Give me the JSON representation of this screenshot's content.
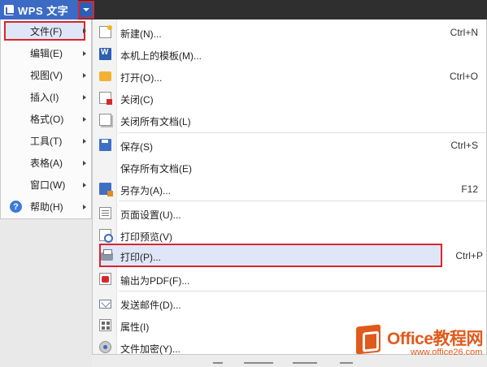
{
  "app": {
    "title": "WPS 文字"
  },
  "main_menu": {
    "items": [
      {
        "label": "文件(F)"
      },
      {
        "label": "编辑(E)"
      },
      {
        "label": "视图(V)"
      },
      {
        "label": "插入(I)"
      },
      {
        "label": "格式(O)"
      },
      {
        "label": "工具(T)"
      },
      {
        "label": "表格(A)"
      },
      {
        "label": "窗口(W)"
      },
      {
        "label": "帮助(H)"
      }
    ]
  },
  "file_menu": {
    "items": [
      {
        "label": "新建(N)...",
        "shortcut": "Ctrl+N",
        "icon": "new-document-icon"
      },
      {
        "label": "本机上的模板(M)...",
        "shortcut": "",
        "icon": "template-icon"
      },
      {
        "label": "打开(O)...",
        "shortcut": "Ctrl+O",
        "icon": "open-folder-icon"
      },
      {
        "label": "关闭(C)",
        "shortcut": "",
        "icon": "close-document-icon"
      },
      {
        "label": "关闭所有文档(L)",
        "shortcut": "",
        "icon": "close-all-icon"
      },
      {
        "label": "保存(S)",
        "shortcut": "Ctrl+S",
        "icon": "save-icon"
      },
      {
        "label": "保存所有文档(E)",
        "shortcut": "",
        "icon": ""
      },
      {
        "label": "另存为(A)...",
        "shortcut": "F12",
        "icon": "save-as-icon"
      },
      {
        "label": "页面设置(U)...",
        "shortcut": "",
        "icon": "page-setup-icon"
      },
      {
        "label": "打印预览(V)",
        "shortcut": "",
        "icon": "print-preview-icon"
      },
      {
        "label": "打印(P)...",
        "shortcut": "Ctrl+P",
        "icon": "printer-icon"
      },
      {
        "label": "输出为PDF(F)...",
        "shortcut": "",
        "icon": "pdf-icon"
      },
      {
        "label": "发送邮件(D)...",
        "shortcut": "",
        "icon": "mail-icon"
      },
      {
        "label": "属性(I)",
        "shortcut": "",
        "icon": "properties-icon"
      },
      {
        "label": "文件加密(Y)...",
        "shortcut": "",
        "icon": "encrypt-icon"
      }
    ]
  },
  "watermark": {
    "title": "Office教程网",
    "url": "www.office26.com"
  },
  "colors": {
    "highlight_border": "#d9262c",
    "highlight_fill": "#dfe6f8",
    "app_blue": "#3b6bc4",
    "watermark": "#e05a1c"
  }
}
